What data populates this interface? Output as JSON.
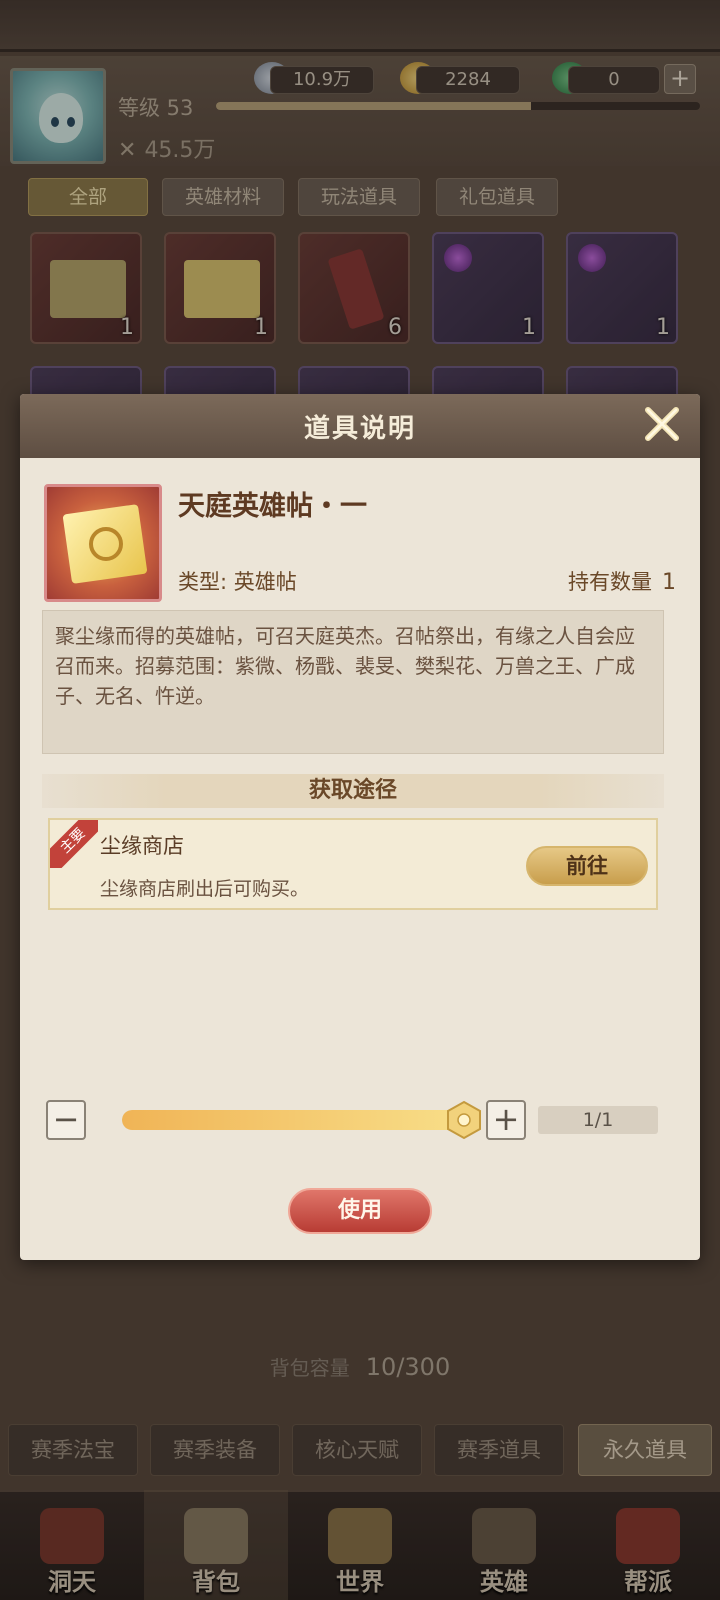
{
  "player": {
    "level_label": "等级 53",
    "level_progress": 0.65,
    "power": "45.5万",
    "silver": "10.9万",
    "gold": "2284",
    "jade": "0"
  },
  "tabs": [
    {
      "label": "全部",
      "active": true
    },
    {
      "label": "英雄材料",
      "active": false
    },
    {
      "label": "玩法道具",
      "active": false
    },
    {
      "label": "礼包道具",
      "active": false
    }
  ],
  "grid_counts": [
    "1",
    "1",
    "6",
    "1",
    "1"
  ],
  "capacity": {
    "label": "背包容量",
    "value": "10/300"
  },
  "bottom_tabs": [
    "赛季法宝",
    "赛季装备",
    "核心天赋",
    "赛季道具",
    "永久道具"
  ],
  "nav": [
    "洞天",
    "背包",
    "世界",
    "英雄",
    "帮派"
  ],
  "dialog": {
    "title": "道具说明",
    "item_name": "天庭英雄帖・一",
    "type_label": "类型: 英雄帖",
    "own_label": "持有数量",
    "own_count": "1",
    "description": "聚尘缘而得的英雄帖，可召天庭英杰。召帖祭出，有缘之人自会应召而来。招募范围：紫微、杨戬、裴旻、樊梨花、万兽之王、广成子、无名、忤逆。",
    "source_header": "获取途径",
    "source": {
      "tag": "主要",
      "name": "尘缘商店",
      "desc": "尘缘商店刷出后可购买。",
      "go_label": "前往"
    },
    "quantity_text": "1/1",
    "quantity_fraction": 1,
    "use_label": "使用"
  },
  "colors": {
    "accent_gold": "#c89e4c",
    "use_red": "#b83c34",
    "dialog_bg": "#ece5d8"
  }
}
